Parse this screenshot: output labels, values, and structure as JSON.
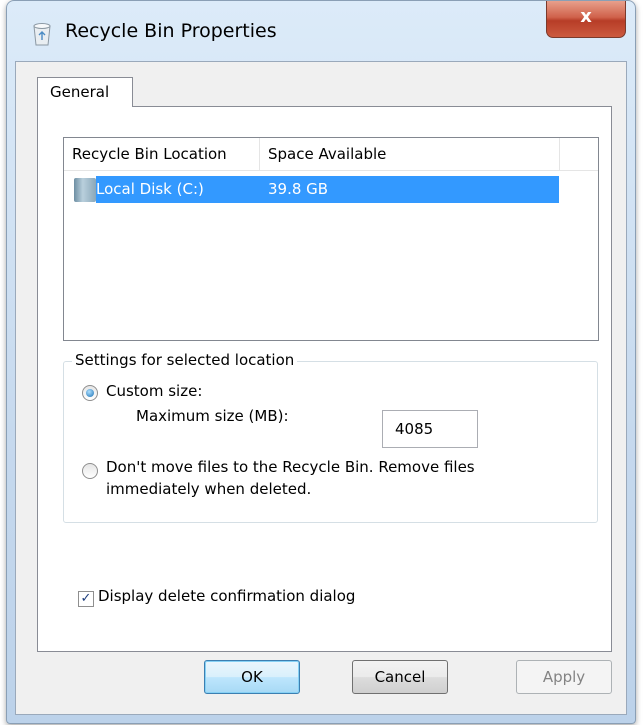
{
  "window": {
    "title": "Recycle Bin Properties",
    "close_label": "x"
  },
  "tabs": [
    {
      "label": "General"
    }
  ],
  "locations": {
    "columns": [
      "Recycle Bin Location",
      "Space Available"
    ],
    "rows": [
      {
        "location": "Local Disk (C:)",
        "space": "39.8 GB",
        "selected": true
      }
    ]
  },
  "settings": {
    "group_label": "Settings for selected location",
    "custom_size_label": "Custom size:",
    "max_size_label": "Maximum size (MB):",
    "max_size_value": "4085",
    "dont_move_label_line1": "Don't move files to the Recycle Bin. Remove files",
    "dont_move_label_line2": "immediately when deleted.",
    "selected_option": "custom_size"
  },
  "confirm": {
    "label": "Display delete confirmation dialog",
    "checked": true
  },
  "buttons": {
    "ok": "OK",
    "cancel": "Cancel",
    "apply": "Apply"
  },
  "icons": {
    "app": "recycle-bin-icon",
    "drive": "hard-drive-icon"
  },
  "colors": {
    "selection": "#3399ff",
    "close_button": "#c9503a"
  }
}
